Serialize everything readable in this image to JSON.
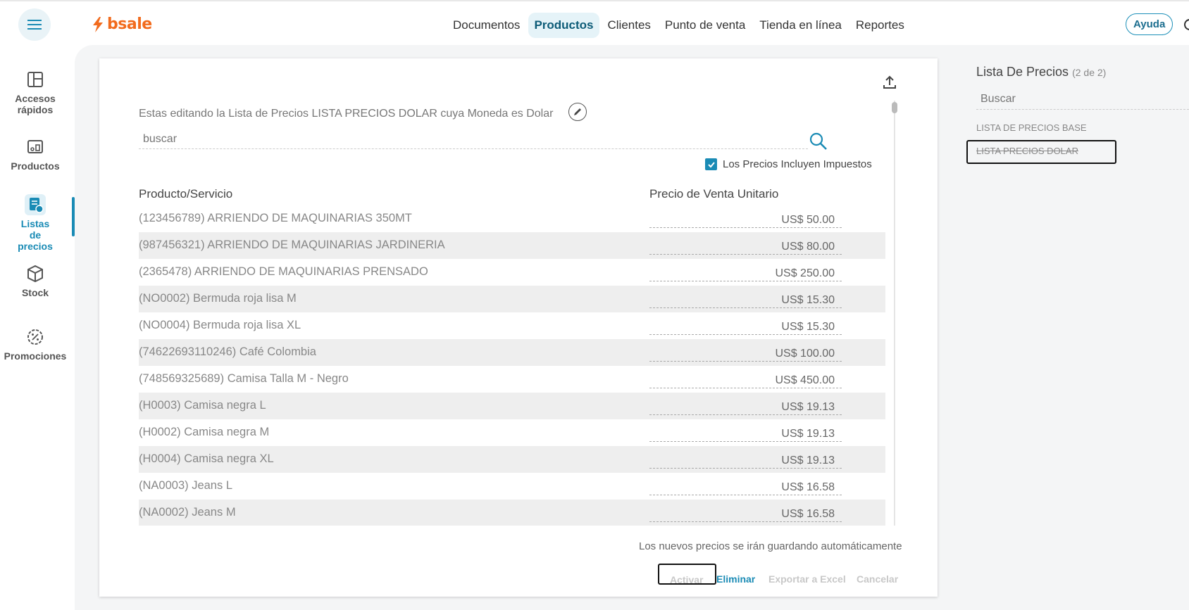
{
  "app": {
    "logo_text": "bsale"
  },
  "nav": {
    "items": [
      {
        "label": "Documentos"
      },
      {
        "label": "Productos",
        "active": true
      },
      {
        "label": "Clientes"
      },
      {
        "label": "Punto de venta"
      },
      {
        "label": "Tienda en línea"
      },
      {
        "label": "Reportes"
      }
    ],
    "help_label": "Ayuda"
  },
  "sidebar": {
    "items": [
      {
        "label": "Accesos rápidos",
        "icon": "layout-icon"
      },
      {
        "label": "Productos",
        "icon": "products-icon"
      },
      {
        "label": "Listas de precios",
        "icon": "price-list-icon",
        "active": true
      },
      {
        "label": "Stock",
        "icon": "box-icon"
      },
      {
        "label": "Promociones",
        "icon": "percent-badge-icon"
      }
    ]
  },
  "editor": {
    "title": "Estas editando la Lista de Precios LISTA PRECIOS DOLAR cuya Moneda es Dolar",
    "search_placeholder": "buscar",
    "tax_checkbox_label": "Los Precios Incluyen Impuestos",
    "tax_checked": true,
    "columns": {
      "product": "Producto/Servicio",
      "price": "Precio de Venta Unitario"
    },
    "rows": [
      {
        "name": "(123456789) ARRIENDO DE MAQUINARIAS 350MT",
        "price": "US$ 50.00"
      },
      {
        "name": "(987456321) ARRIENDO DE MAQUINARIAS JARDINERIA",
        "price": "US$ 80.00"
      },
      {
        "name": "(2365478) ARRIENDO DE MAQUINARIAS PRENSADO",
        "price": "US$ 250.00"
      },
      {
        "name": "(NO0002) Bermuda roja lisa M",
        "price": "US$ 15.30"
      },
      {
        "name": "(NO0004) Bermuda roja lisa XL",
        "price": "US$ 15.30"
      },
      {
        "name": "(74622693110246) Café Colombia",
        "price": "US$ 100.00"
      },
      {
        "name": "(748569325689) Camisa Talla M - Negro",
        "price": "US$ 450.00"
      },
      {
        "name": "(H0003) Camisa negra L",
        "price": "US$ 19.13"
      },
      {
        "name": "(H0002) Camisa negra M",
        "price": "US$ 19.13"
      },
      {
        "name": "(H0004) Camisa negra XL",
        "price": "US$ 19.13"
      },
      {
        "name": "(NA0003) Jeans L",
        "price": "US$ 16.58"
      },
      {
        "name": "(NA0002) Jeans M",
        "price": "US$ 16.58"
      }
    ],
    "autosave_note": "Los nuevos precios se irán guardando automáticamente",
    "actions": {
      "activate": "Activar",
      "delete": "Eliminar",
      "export": "Exportar a Excel",
      "cancel": "Cancelar"
    }
  },
  "right_panel": {
    "title": "Lista De Precios",
    "count": "(2 de 2)",
    "search_placeholder": "Buscar",
    "lists": [
      {
        "label": "LISTA DE PRECIOS BASE"
      },
      {
        "label": "LISTA PRECIOS DOLAR",
        "inactive": true
      }
    ]
  },
  "colors": {
    "accent": "#1a8bb5",
    "brand": "#f26b1d",
    "nav_active_bg": "#e5f3f8"
  }
}
